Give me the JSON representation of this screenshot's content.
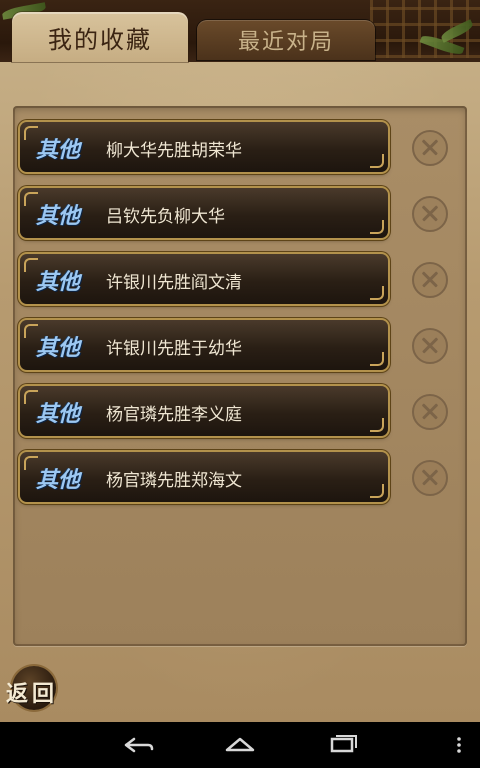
{
  "tabs": [
    {
      "label": "我的收藏",
      "active": true
    },
    {
      "label": "最近对局",
      "active": false
    }
  ],
  "favorites": [
    {
      "tag": "其他",
      "title": "柳大华先胜胡荣华"
    },
    {
      "tag": "其他",
      "title": "吕钦先负柳大华"
    },
    {
      "tag": "其他",
      "title": "许银川先胜阎文清"
    },
    {
      "tag": "其他",
      "title": "许银川先胜于幼华"
    },
    {
      "tag": "其他",
      "title": "杨官璘先胜李义庭"
    },
    {
      "tag": "其他",
      "title": "杨官璘先胜郑海文"
    }
  ],
  "back_button": {
    "label": "返回"
  },
  "icons": {
    "delete": "close-circle-icon",
    "nav_back": "back-arrow-icon",
    "nav_home": "home-icon",
    "nav_recent": "recent-apps-icon",
    "nav_menu": "overflow-menu-icon"
  },
  "colors": {
    "tag_blue": "#9cc8f2",
    "item_border_gold": "#b3924c",
    "panel_tan": "#a98d66"
  }
}
